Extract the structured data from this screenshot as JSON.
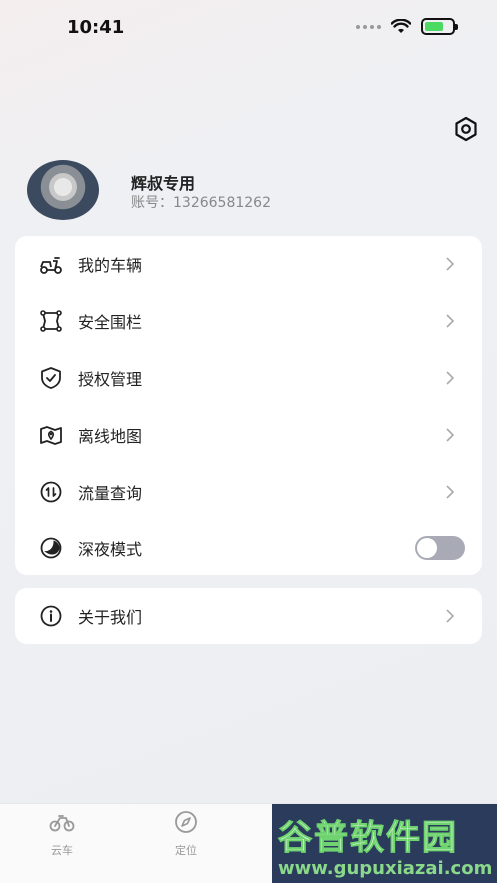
{
  "status_bar": {
    "time": "10:41"
  },
  "profile": {
    "name": "辉叔专用",
    "account": "账号：13266581262"
  },
  "menu": {
    "items": [
      {
        "label": "我的车辆",
        "icon": "scooter-icon"
      },
      {
        "label": "安全围栏",
        "icon": "fence-icon"
      },
      {
        "label": "授权管理",
        "icon": "shield-icon"
      },
      {
        "label": "离线地图",
        "icon": "map-icon"
      },
      {
        "label": "流量查询",
        "icon": "data-traffic-icon"
      },
      {
        "label": "深夜模式",
        "icon": "moon-icon",
        "toggle": false
      }
    ]
  },
  "about": {
    "label": "关于我们",
    "icon": "info-icon"
  },
  "tabbar": {
    "tabs": [
      {
        "label": "云车",
        "icon": "bike-icon"
      },
      {
        "label": "定位",
        "icon": "compass-icon"
      }
    ]
  },
  "watermark": {
    "title": "谷普软件园",
    "url": "www.gupuxiazai.com"
  },
  "colors": {
    "accent": "#222222",
    "toggle_off": "#a8abb6",
    "background": "#eceef2"
  }
}
